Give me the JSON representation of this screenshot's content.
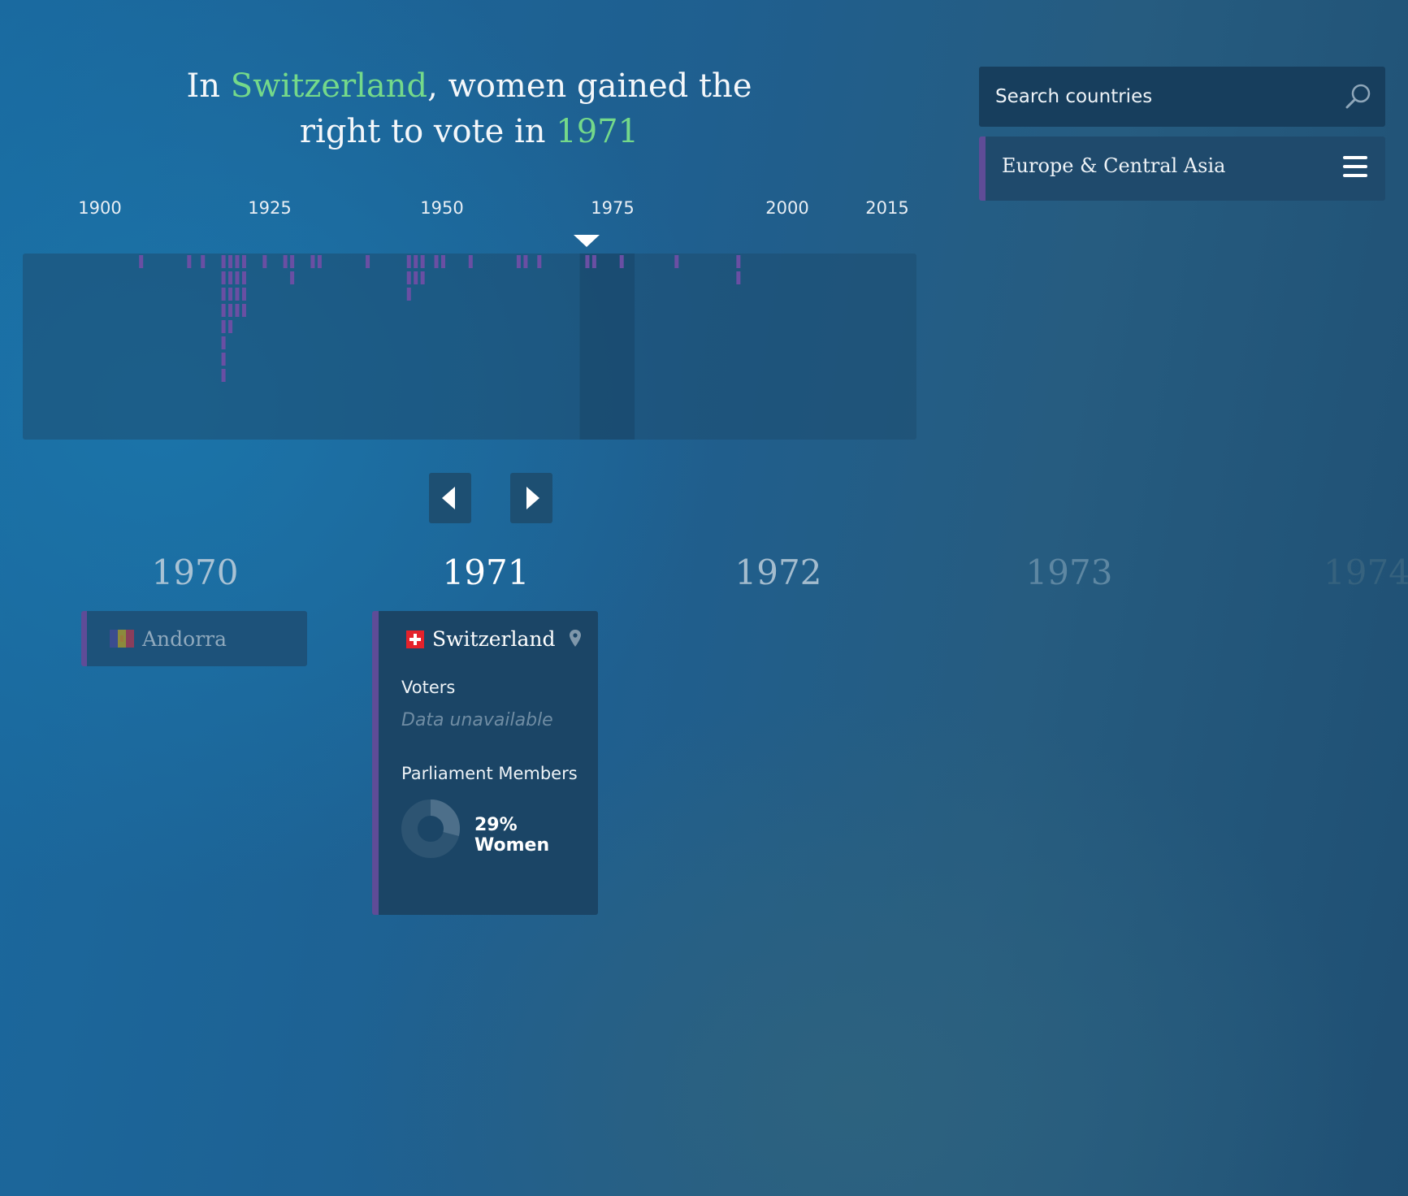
{
  "headline": {
    "prefix": "In ",
    "country": "Switzerland",
    "middle": ", women gained the right to vote in ",
    "year": "1971"
  },
  "search": {
    "placeholder": "Search countries"
  },
  "region_filter": {
    "label": "Europe & Central Asia"
  },
  "colors": {
    "accent_green": "#74d98a",
    "bar_purple": "#6a4fa3",
    "card_border": "#5f4c97"
  },
  "icons": {
    "search": "search-icon",
    "menu": "hamburger-menu-icon",
    "prev": "triangle-left-icon",
    "next": "triangle-right-icon",
    "pin": "map-pin-icon"
  },
  "timeline_axis": {
    "labels": [
      "1900",
      "1925",
      "1950",
      "1975",
      "2000",
      "2015"
    ]
  },
  "chart_data": {
    "type": "bar",
    "description_units": "countries granting women's suffrage per year (stacked markers)",
    "x_range": [
      1893,
      2022
    ],
    "x_ticks": [
      1900,
      1925,
      1950,
      1975,
      2000,
      2015
    ],
    "selected_year": 1971,
    "selected_window": [
      1970,
      1978
    ],
    "points": [
      {
        "year": 1906,
        "count": 1
      },
      {
        "year": 1913,
        "count": 1
      },
      {
        "year": 1915,
        "count": 1
      },
      {
        "year": 1918,
        "count": 8
      },
      {
        "year": 1919,
        "count": 5
      },
      {
        "year": 1920,
        "count": 4
      },
      {
        "year": 1921,
        "count": 4
      },
      {
        "year": 1924,
        "count": 1
      },
      {
        "year": 1927,
        "count": 1
      },
      {
        "year": 1928,
        "count": 2
      },
      {
        "year": 1931,
        "count": 1
      },
      {
        "year": 1932,
        "count": 1
      },
      {
        "year": 1939,
        "count": 1
      },
      {
        "year": 1945,
        "count": 3
      },
      {
        "year": 1946,
        "count": 2
      },
      {
        "year": 1947,
        "count": 2
      },
      {
        "year": 1949,
        "count": 1
      },
      {
        "year": 1950,
        "count": 1
      },
      {
        "year": 1954,
        "count": 1
      },
      {
        "year": 1961,
        "count": 1
      },
      {
        "year": 1962,
        "count": 1
      },
      {
        "year": 1964,
        "count": 1
      },
      {
        "year": 1971,
        "count": 1
      },
      {
        "year": 1972,
        "count": 1
      },
      {
        "year": 1976,
        "count": 1
      },
      {
        "year": 1984,
        "count": 1
      },
      {
        "year": 1993,
        "count": 2
      }
    ]
  },
  "nav": {
    "prev_label": "",
    "next_label": ""
  },
  "years": [
    {
      "label": "1970",
      "state": "near"
    },
    {
      "label": "1971",
      "state": "current"
    },
    {
      "label": "1972",
      "state": "near"
    },
    {
      "label": "1973",
      "state": "far"
    },
    {
      "label": "1974",
      "state": "farthest"
    }
  ],
  "entries": {
    "y1970": [
      {
        "country": "Andorra",
        "flag": "andorra-flag-icon"
      }
    ],
    "y1971": {
      "country": "Switzerland",
      "flag": "swiss-flag-icon",
      "voters_label": "Voters",
      "voters_value": "Data unavailable",
      "parliament_label": "Parliament Members",
      "women_pct": 29,
      "women_text": "29% Women"
    }
  }
}
